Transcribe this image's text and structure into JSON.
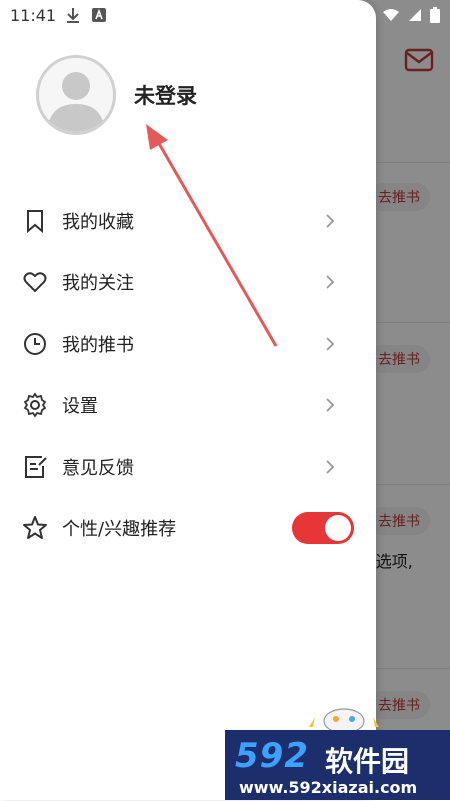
{
  "status_bar": {
    "time": "11:41"
  },
  "drawer": {
    "profile_name": "未登录",
    "menu": [
      {
        "label": "我的收藏",
        "icon": "bookmark-icon"
      },
      {
        "label": "我的关注",
        "icon": "heart-icon"
      },
      {
        "label": "我的推书",
        "icon": "clock-icon"
      },
      {
        "label": "设置",
        "icon": "gear-icon"
      },
      {
        "label": "意见反馈",
        "icon": "feedback-icon"
      },
      {
        "label": "个性/兴趣推荐",
        "icon": "star-icon"
      }
    ],
    "recommend_toggle_on": true
  },
  "background": {
    "recommend_button_label": "去推书",
    "partial_text": "-选项,"
  },
  "watermark": {
    "brand_num": "592",
    "brand_cn": "软件园",
    "url": "www.592xiazai.com"
  },
  "colors": {
    "accent": "#e63637",
    "watermark_bg": "#1c2f6c"
  }
}
